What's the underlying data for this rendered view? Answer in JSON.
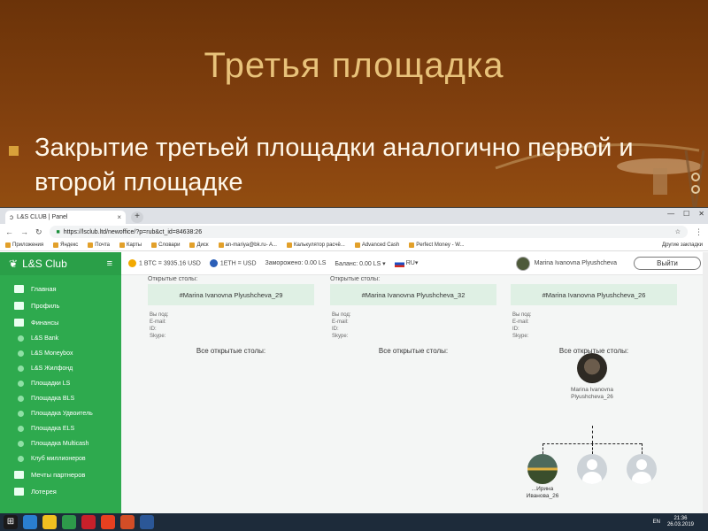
{
  "slide": {
    "title": "Третья площадка",
    "bullet": "Закрытие третьей площадки аналогично первой и второй площадке"
  },
  "browser": {
    "tab_title": "L&S CLUB | Panel",
    "tab_close": "×",
    "new_tab": "+",
    "url": "https://lsclub.ltd/newoffice/?p=rub&ct_id=84638:26",
    "nav_back": "←",
    "nav_forward": "→",
    "nav_reload": "↻",
    "home": "⌂",
    "star": "☆",
    "menu": "⋮",
    "win_min": "—",
    "win_max": "☐",
    "win_close": "✕",
    "bookmarks": [
      "Приложения",
      "Яндекс",
      "Почта",
      "Карты",
      "Словари",
      "Диск",
      "an-mariya@bk.ru- A...",
      "Калькулятор расчё...",
      "Advanced Cash",
      "Perfect Money - W..."
    ],
    "bookmarks_other": "Другие закладки"
  },
  "app": {
    "logo": "L&S Club",
    "burger": "≡",
    "nav_main": [
      "Главная",
      "Профиль",
      "Финансы"
    ],
    "nav_sub": [
      "L&S Bank",
      "L&S Moneybox",
      "L&S Жилфонд",
      "Площадки LS",
      "Площадка BLS",
      "Площадка Удвоитель",
      "Площадка ELS",
      "Площадка Multicash",
      "Клуб миллионеров"
    ],
    "nav_bottom": [
      "Мечты партнеров",
      "Лотерея"
    ],
    "topbar": {
      "btc": "1 BTC = 3935.16 USD",
      "eth": "1ETH = USD",
      "frozen": "Заморожено: 0.00 LS",
      "balance": "Баланс: 0.00 LS ▾",
      "lang": "RU▾",
      "user": "Marina Ivanovna Plyushcheva",
      "exit": "Выйти"
    },
    "columns": [
      {
        "header": "Открытые столы:",
        "table": "#Marina Ivanovna Plyushcheva_29",
        "info": [
          "Вы под:",
          "E-mail:",
          "ID:",
          "Skype:"
        ],
        "all": "Все открытые столы:"
      },
      {
        "header": "Открытые столы:",
        "table": "#Marina Ivanovna Plyushcheva_32",
        "info": [
          "Вы под:",
          "E-mail:",
          "ID:",
          "Skype:"
        ],
        "all": "Все открытые столы:"
      },
      {
        "header": "",
        "table": "#Marina Ivanovna Plyushcheva_26",
        "info": [
          "Вы под:",
          "E-mail:",
          "ID:",
          "Skype:"
        ],
        "all": "Все открытые столы:"
      }
    ],
    "tree": {
      "root_name": "Marina Ivanovna Plyushcheva_26",
      "child_name": "...Ирина Иванова_26"
    }
  },
  "taskbar": {
    "lang": "EN",
    "time": "21:36",
    "date": "26.03.2019"
  }
}
